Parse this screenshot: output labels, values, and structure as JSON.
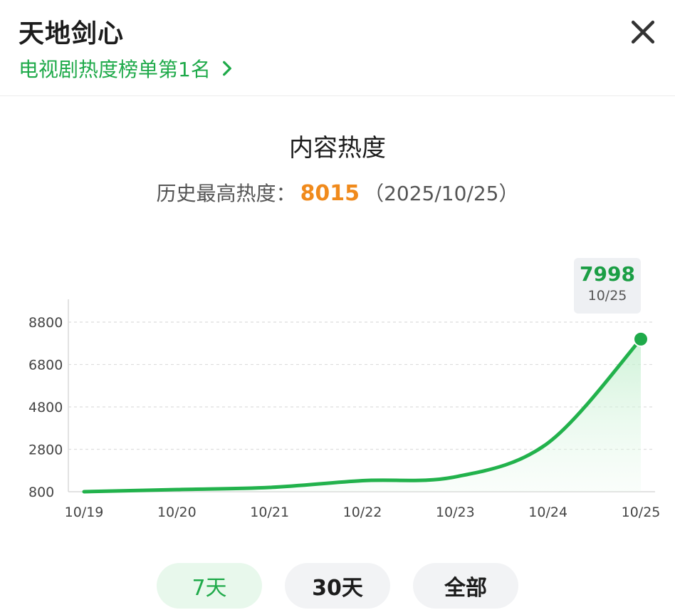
{
  "header": {
    "title": "天地剑心",
    "ranking_link": "电视剧热度榜单第1名",
    "close_icon": "close-icon",
    "link_icon": "chevron-right-icon"
  },
  "heat": {
    "section_title": "内容热度",
    "peak_label": "历史最高热度：",
    "peak_value": "8015",
    "peak_date": "（2025/10/25）"
  },
  "colors": {
    "accent_green": "#1faa4a",
    "peak_orange": "#f08a1c",
    "area_fill": "#e6f7ea"
  },
  "chart_data": {
    "type": "area",
    "x": [
      "10/19",
      "10/20",
      "10/21",
      "10/22",
      "10/23",
      "10/24",
      "10/25"
    ],
    "series": [
      {
        "values": [
          800,
          900,
          1000,
          1320,
          1500,
          3100,
          7998
        ]
      }
    ],
    "y_ticks": [
      "8800",
      "6800",
      "4800",
      "2800",
      "800"
    ],
    "ylim": [
      800,
      8800
    ],
    "grid": true,
    "tooltip": {
      "value": "7998",
      "date": "10/25"
    }
  },
  "tabs": [
    {
      "label": "7天",
      "active": true
    },
    {
      "label": "30天",
      "active": false
    },
    {
      "label": "全部",
      "active": false
    }
  ]
}
